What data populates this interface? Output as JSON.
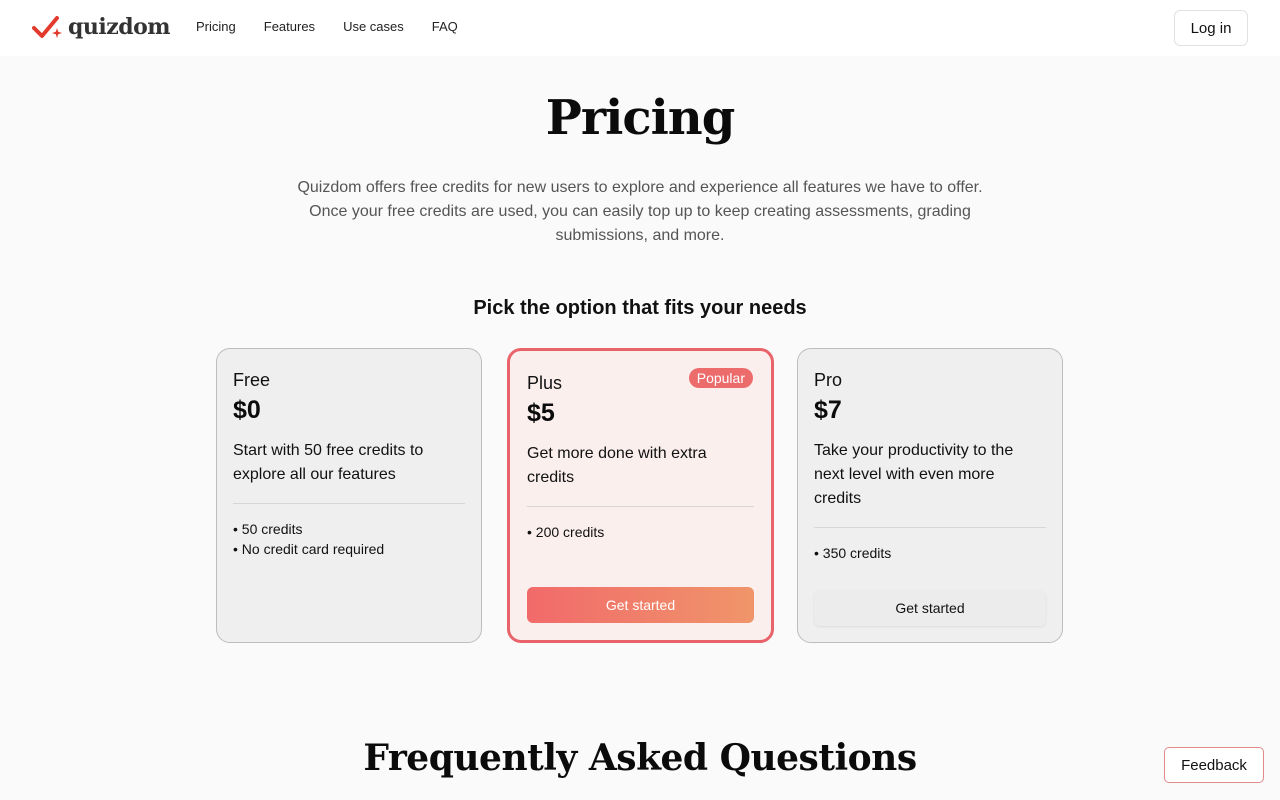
{
  "nav": {
    "logo_text": "quizdom",
    "links": [
      "Pricing",
      "Features",
      "Use cases",
      "FAQ"
    ],
    "login_label": "Log in"
  },
  "hero": {
    "title": "Pricing",
    "intro": "Quizdom offers free credits for new users to explore and experience all features we have to offer. Once your free credits are used, you can easily top up to keep creating assessments, grading submissions, and more.",
    "subheading": "Pick the option that fits your needs"
  },
  "plans": [
    {
      "name": "Free",
      "price": "$0",
      "description": "Start with 50 free credits to explore all our features",
      "features": [
        "• 50 credits",
        "• No credit card required"
      ]
    },
    {
      "name": "Plus",
      "price": "$5",
      "badge": "Popular",
      "description": "Get more done with extra credits",
      "features": [
        "• 200 credits"
      ],
      "cta": "Get started"
    },
    {
      "name": "Pro",
      "price": "$7",
      "description": "Take your productivity to the next level with even more credits",
      "features": [
        "• 350 credits"
      ],
      "cta": "Get started"
    }
  ],
  "faq": {
    "title": "Frequently Asked Questions"
  },
  "feedback_label": "Feedback",
  "colors": {
    "accent": "#e8646a",
    "badge": "#ec6b6b",
    "gradient_start": "#f16a6a",
    "gradient_end": "#f0956a",
    "background": "#fafafa"
  }
}
